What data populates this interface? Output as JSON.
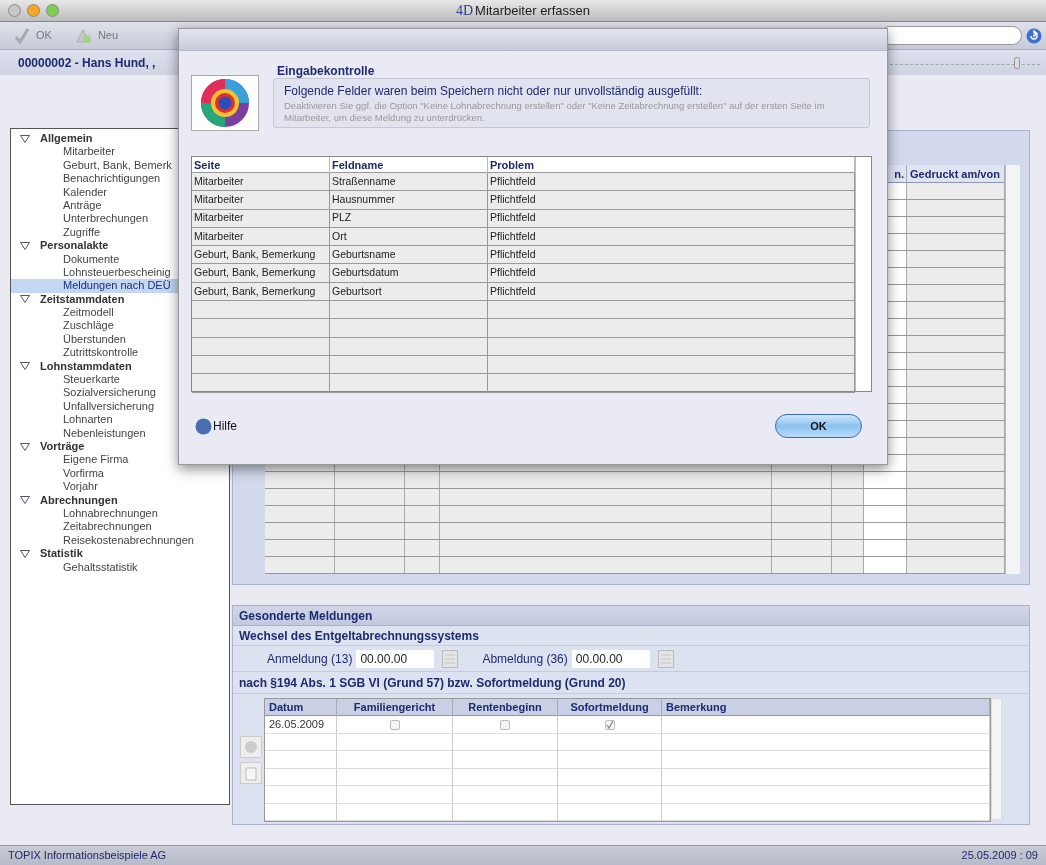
{
  "window": {
    "logo": "4D",
    "title": "Mitarbeiter erfassen"
  },
  "toolbar": {
    "buttons": [
      {
        "label": "OK",
        "kind": "check",
        "disabled": true
      },
      {
        "label": "Neu",
        "kind": "new",
        "disabled": true
      }
    ]
  },
  "record_title": "00000002 - Hans Hund, ,",
  "record_slider": {
    "level": 0.86
  },
  "sidebar": {
    "items": [
      {
        "label": "Allgemein",
        "expanded": true,
        "children": [
          {
            "label": "Mitarbeiter",
            "selected": false
          },
          {
            "label": "Geburt, Bank, Bemerk",
            "selected": false
          },
          {
            "label": "Benachrichtigungen",
            "selected": false
          },
          {
            "label": "Kalender",
            "selected": false
          },
          {
            "label": "Anträge",
            "selected": false
          },
          {
            "label": "Unterbrechungen",
            "selected": false
          },
          {
            "label": "Zugriffe",
            "selected": false
          }
        ]
      },
      {
        "label": "Personalakte",
        "expanded": true,
        "children": [
          {
            "label": "Dokumente",
            "selected": false
          },
          {
            "label": "Lohnsteuerbescheinig",
            "selected": false
          },
          {
            "label": "Meldungen nach DEÜ",
            "selected": true
          }
        ]
      },
      {
        "label": "Zeitstammdaten",
        "expanded": true,
        "children": [
          {
            "label": "Zeitmodell",
            "selected": false
          },
          {
            "label": "Zuschläge",
            "selected": false
          },
          {
            "label": "Überstunden",
            "selected": false
          },
          {
            "label": "Zutrittskontrolle",
            "selected": false
          }
        ]
      },
      {
        "label": "Lohnstammdaten",
        "expanded": true,
        "children": [
          {
            "label": "Steuerkarte",
            "selected": false
          },
          {
            "label": "Sozialversicherung",
            "selected": false
          },
          {
            "label": "Unfallversicherung",
            "selected": false
          },
          {
            "label": "Lohnarten",
            "selected": false
          },
          {
            "label": "Nebenleistungen",
            "selected": false
          }
        ]
      },
      {
        "label": "Vorträge",
        "expanded": true,
        "children": [
          {
            "label": "Eigene Firma",
            "selected": false
          },
          {
            "label": "Vorfirma",
            "selected": false
          },
          {
            "label": "Vorjahr",
            "selected": false
          }
        ]
      },
      {
        "label": "Abrechnungen",
        "expanded": true,
        "children": [
          {
            "label": "Lohnabrechnungen",
            "selected": false
          },
          {
            "label": "Zeitabrechnungen",
            "selected": false
          },
          {
            "label": "Reisekostenabrechnungen",
            "selected": false
          }
        ]
      },
      {
        "label": "Statistik",
        "expanded": true,
        "children": [
          {
            "label": "Gehaltsstatistik",
            "selected": false
          }
        ]
      }
    ]
  },
  "main_table": {
    "header_cells": [
      "n.",
      "Gedruckt am/von"
    ]
  },
  "special_reports": {
    "title": "Gesonderte Meldungen",
    "change_section": {
      "title": "Wechsel des Entgeltabrechnungssystems",
      "fields": [
        {
          "label": "Anmeldung (13)",
          "value": "00.00.00"
        },
        {
          "label": "Abmeldung (36)",
          "value": "00.00.00"
        }
      ]
    },
    "section_194": {
      "title": "nach §194 Abs. 1 SGB VI (Grund 57) bzw. Sofortmeldung (Grund 20)",
      "columns": [
        "Datum",
        "Familiengericht",
        "Rentenbeginn",
        "Sofortmeldung",
        "Bemerkung"
      ],
      "rows": [
        {
          "datum": "26.05.2009",
          "familiengericht": false,
          "rentenbeginn": false,
          "sofortmeldung": true
        }
      ]
    }
  },
  "status_bar": {
    "company": "TOPIX Informationsbeispiele AG",
    "datetime": "25.05.2009 : 09"
  },
  "dialog": {
    "title": "Eingabekontrolle",
    "message": "Folgende Felder waren beim Speichern nicht oder nur unvollständig ausgefüllt:",
    "hint": "Deaktivieren Sie ggf. die Option \"Keine Lohnabrechnung erstellen\" oder \"Keine Zeitabrechnung erstellen\" auf der ersten Seite im Mitarbeiter, um diese Meldung zu unterdrücken.",
    "table": {
      "columns": [
        "Seite",
        "Feldname",
        "Problem"
      ],
      "rows": [
        [
          "Mitarbeiter",
          "Straßenname",
          "Pflichtfeld"
        ],
        [
          "Mitarbeiter",
          "Hausnummer",
          "Pflichtfeld"
        ],
        [
          "Mitarbeiter",
          "PLZ",
          "Pflichtfeld"
        ],
        [
          "Mitarbeiter",
          "Ort",
          "Pflichtfeld"
        ],
        [
          "Geburt, Bank, Bemerkung",
          "Geburtsname",
          "Pflichtfeld"
        ],
        [
          "Geburt, Bank, Bemerkung",
          "Geburtsdatum",
          "Pflichtfeld"
        ],
        [
          "Geburt, Bank, Bemerkung",
          "Geburtsort",
          "Pflichtfeld"
        ]
      ]
    },
    "help": "Hilfe",
    "ok": "OK"
  }
}
